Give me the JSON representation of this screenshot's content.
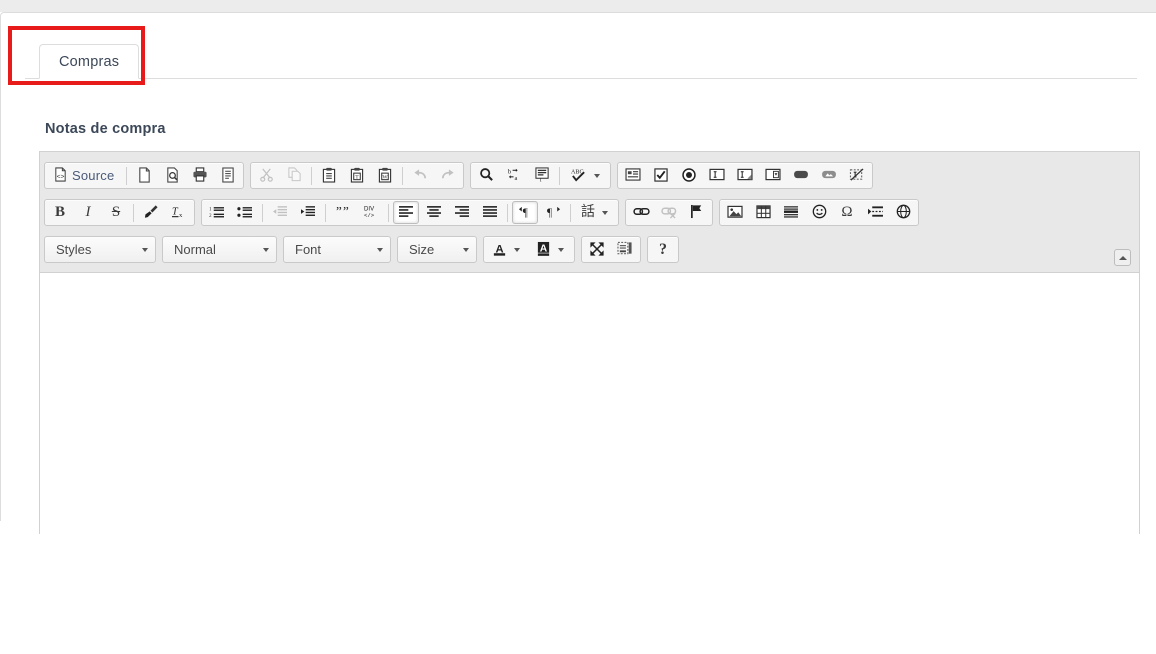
{
  "window": {
    "background_band_color": "#ececec",
    "panel_background": "#ffffff",
    "annotation_color": "#e81b1b"
  },
  "tabs": {
    "items": [
      {
        "label": "Compras",
        "active": true
      }
    ]
  },
  "form": {
    "field_label": "Notas de compra"
  },
  "editor": {
    "name": "ckeditor",
    "content_value": "",
    "toolbar": {
      "collapse_button": "collapse-toolbar",
      "rows": [
        {
          "groups": [
            {
              "name": "document",
              "buttons": [
                {
                  "name": "source-button",
                  "label": "Source",
                  "icon": "source-code-icon",
                  "type": "text-icon",
                  "state": "enabled"
                },
                {
                  "name": "new-page-button",
                  "label": "",
                  "icon": "new-page-icon",
                  "type": "icon",
                  "state": "enabled"
                },
                {
                  "name": "preview-button",
                  "label": "",
                  "icon": "preview-icon",
                  "type": "icon",
                  "state": "enabled"
                },
                {
                  "name": "print-button",
                  "label": "",
                  "icon": "print-icon",
                  "type": "icon",
                  "state": "enabled"
                },
                {
                  "name": "templates-button",
                  "label": "",
                  "icon": "templates-icon",
                  "type": "icon",
                  "state": "enabled"
                }
              ]
            },
            {
              "name": "clipboard",
              "buttons": [
                {
                  "name": "cut-button",
                  "label": "",
                  "icon": "scissors-icon",
                  "type": "icon",
                  "state": "disabled"
                },
                {
                  "name": "copy-button",
                  "label": "",
                  "icon": "copy-icon",
                  "type": "icon",
                  "state": "disabled"
                },
                {
                  "name": "paste-button",
                  "label": "",
                  "icon": "paste-icon",
                  "type": "icon",
                  "state": "enabled"
                },
                {
                  "name": "paste-text-button",
                  "label": "",
                  "icon": "paste-as-text-icon",
                  "type": "icon",
                  "state": "enabled"
                },
                {
                  "name": "paste-word-button",
                  "label": "",
                  "icon": "paste-from-word-icon",
                  "type": "icon",
                  "state": "enabled"
                },
                {
                  "name": "undo-button",
                  "label": "",
                  "icon": "undo-arrow-icon",
                  "type": "icon",
                  "state": "disabled"
                },
                {
                  "name": "redo-button",
                  "label": "",
                  "icon": "redo-arrow-icon",
                  "type": "icon",
                  "state": "disabled"
                }
              ]
            },
            {
              "name": "editing",
              "buttons": [
                {
                  "name": "find-button",
                  "label": "",
                  "icon": "magnifier-icon",
                  "type": "icon",
                  "state": "enabled"
                },
                {
                  "name": "replace-button",
                  "label": "",
                  "icon": "replace-icon",
                  "type": "icon",
                  "state": "enabled"
                },
                {
                  "name": "select-all-button",
                  "label": "",
                  "icon": "select-all-icon",
                  "type": "icon",
                  "state": "enabled"
                },
                {
                  "name": "spellcheck-button",
                  "label": "",
                  "icon": "spellcheck-abc-icon",
                  "type": "icon-dropdown",
                  "state": "enabled"
                }
              ]
            },
            {
              "name": "forms",
              "buttons": [
                {
                  "name": "form-button",
                  "label": "",
                  "icon": "form-icon",
                  "type": "icon",
                  "state": "enabled"
                },
                {
                  "name": "checkbox-button",
                  "label": "",
                  "icon": "checkbox-icon",
                  "type": "icon",
                  "state": "enabled"
                },
                {
                  "name": "radio-button",
                  "label": "",
                  "icon": "radio-button-icon",
                  "type": "icon",
                  "state": "enabled"
                },
                {
                  "name": "text-field-button",
                  "label": "",
                  "icon": "text-field-icon",
                  "type": "icon",
                  "state": "enabled"
                },
                {
                  "name": "textarea-button",
                  "label": "",
                  "icon": "textarea-icon",
                  "type": "icon",
                  "state": "enabled"
                },
                {
                  "name": "select-field-button",
                  "label": "",
                  "icon": "select-field-icon",
                  "type": "icon",
                  "state": "enabled"
                },
                {
                  "name": "form-button-button",
                  "label": "",
                  "icon": "button-icon",
                  "type": "icon",
                  "state": "enabled"
                },
                {
                  "name": "image-button-button",
                  "label": "",
                  "icon": "image-button-icon",
                  "type": "icon",
                  "state": "enabled"
                },
                {
                  "name": "hidden-field-button",
                  "label": "",
                  "icon": "hidden-field-icon",
                  "type": "icon",
                  "state": "enabled"
                }
              ]
            }
          ]
        },
        {
          "groups": [
            {
              "name": "basic-styles",
              "buttons": [
                {
                  "name": "bold-button",
                  "label": "B",
                  "icon": "bold-icon",
                  "type": "glyph",
                  "state": "enabled"
                },
                {
                  "name": "italic-button",
                  "label": "I",
                  "icon": "italic-icon",
                  "type": "glyph",
                  "state": "enabled"
                },
                {
                  "name": "strike-button",
                  "label": "S",
                  "icon": "strikethrough-icon",
                  "type": "glyph",
                  "state": "enabled"
                },
                {
                  "name": "remove-format-button",
                  "label": "",
                  "icon": "brush-icon",
                  "type": "icon",
                  "state": "enabled"
                },
                {
                  "name": "clear-format-button",
                  "label": "",
                  "icon": "tx-remove-format-icon",
                  "type": "icon",
                  "state": "enabled"
                }
              ]
            },
            {
              "name": "paragraph",
              "buttons": [
                {
                  "name": "numbered-list-button",
                  "label": "",
                  "icon": "numbered-list-icon",
                  "type": "icon",
                  "state": "enabled"
                },
                {
                  "name": "bulleted-list-button",
                  "label": "",
                  "icon": "bulleted-list-icon",
                  "type": "icon",
                  "state": "enabled"
                },
                {
                  "name": "outdent-button",
                  "label": "",
                  "icon": "decrease-indent-icon",
                  "type": "icon",
                  "state": "disabled"
                },
                {
                  "name": "indent-button",
                  "label": "",
                  "icon": "increase-indent-icon",
                  "type": "icon",
                  "state": "enabled"
                },
                {
                  "name": "blockquote-button",
                  "label": "",
                  "icon": "blockquote-icon",
                  "type": "icon",
                  "state": "enabled"
                },
                {
                  "name": "create-div-button",
                  "label": "",
                  "icon": "div-container-icon",
                  "type": "icon",
                  "state": "enabled"
                },
                {
                  "name": "align-left-button",
                  "label": "",
                  "icon": "align-left-icon",
                  "type": "icon",
                  "state": "active"
                },
                {
                  "name": "align-center-button",
                  "label": "",
                  "icon": "align-center-icon",
                  "type": "icon",
                  "state": "enabled"
                },
                {
                  "name": "align-right-button",
                  "label": "",
                  "icon": "align-right-icon",
                  "type": "icon",
                  "state": "enabled"
                },
                {
                  "name": "justify-button",
                  "label": "",
                  "icon": "justify-icon",
                  "type": "icon",
                  "state": "enabled"
                },
                {
                  "name": "ltr-button",
                  "label": "",
                  "icon": "text-direction-ltr-icon",
                  "type": "icon",
                  "state": "active"
                },
                {
                  "name": "rtl-button",
                  "label": "",
                  "icon": "text-direction-rtl-icon",
                  "type": "icon",
                  "state": "enabled"
                },
                {
                  "name": "language-button",
                  "label": "",
                  "icon": "language-icon",
                  "type": "icon-dropdown",
                  "state": "enabled"
                }
              ]
            },
            {
              "name": "links",
              "buttons": [
                {
                  "name": "link-button",
                  "label": "",
                  "icon": "link-icon",
                  "type": "icon",
                  "state": "enabled"
                },
                {
                  "name": "unlink-button",
                  "label": "",
                  "icon": "unlink-icon",
                  "type": "icon",
                  "state": "disabled"
                },
                {
                  "name": "anchor-button",
                  "label": "",
                  "icon": "anchor-flag-icon",
                  "type": "icon",
                  "state": "enabled"
                }
              ]
            },
            {
              "name": "insert",
              "buttons": [
                {
                  "name": "image-button",
                  "label": "",
                  "icon": "image-icon",
                  "type": "icon",
                  "state": "enabled"
                },
                {
                  "name": "table-button",
                  "label": "",
                  "icon": "table-icon",
                  "type": "icon",
                  "state": "enabled"
                },
                {
                  "name": "horizontal-rule-button",
                  "label": "",
                  "icon": "horizontal-rule-icon",
                  "type": "icon",
                  "state": "enabled"
                },
                {
                  "name": "smiley-button",
                  "label": "",
                  "icon": "smiley-icon",
                  "type": "icon",
                  "state": "enabled"
                },
                {
                  "name": "special-char-button",
                  "label": "Ω",
                  "icon": "omega-icon",
                  "type": "glyph",
                  "state": "enabled"
                },
                {
                  "name": "page-break-button",
                  "label": "",
                  "icon": "page-break-icon",
                  "type": "icon",
                  "state": "enabled"
                },
                {
                  "name": "iframe-button",
                  "label": "",
                  "icon": "globe-iframe-icon",
                  "type": "icon",
                  "state": "enabled"
                }
              ]
            }
          ]
        },
        {
          "groups": [
            {
              "name": "styles-combo",
              "combo": {
                "name": "styles-dropdown",
                "value": "Styles"
              }
            },
            {
              "name": "format-combo",
              "combo": {
                "name": "paragraph-format-dropdown",
                "value": "Normal"
              }
            },
            {
              "name": "font-combo",
              "combo": {
                "name": "font-family-dropdown",
                "value": "Font"
              }
            },
            {
              "name": "size-combo",
              "combo": {
                "name": "font-size-dropdown",
                "value": "Size"
              }
            },
            {
              "name": "colors",
              "buttons": [
                {
                  "name": "text-color-button",
                  "label": "A",
                  "icon": "text-color-icon",
                  "type": "glyph-dropdown",
                  "state": "enabled"
                },
                {
                  "name": "background-color-button",
                  "label": "A",
                  "icon": "background-color-icon",
                  "type": "glyph-dropdown",
                  "state": "enabled"
                }
              ]
            },
            {
              "name": "tools",
              "buttons": [
                {
                  "name": "maximize-button",
                  "label": "",
                  "icon": "maximize-icon",
                  "type": "icon",
                  "state": "enabled"
                },
                {
                  "name": "show-blocks-button",
                  "label": "",
                  "icon": "show-blocks-icon",
                  "type": "icon",
                  "state": "enabled"
                }
              ]
            },
            {
              "name": "about",
              "buttons": [
                {
                  "name": "about-button",
                  "label": "?",
                  "icon": "question-mark-icon",
                  "type": "glyph",
                  "state": "enabled"
                }
              ]
            }
          ]
        }
      ]
    }
  }
}
